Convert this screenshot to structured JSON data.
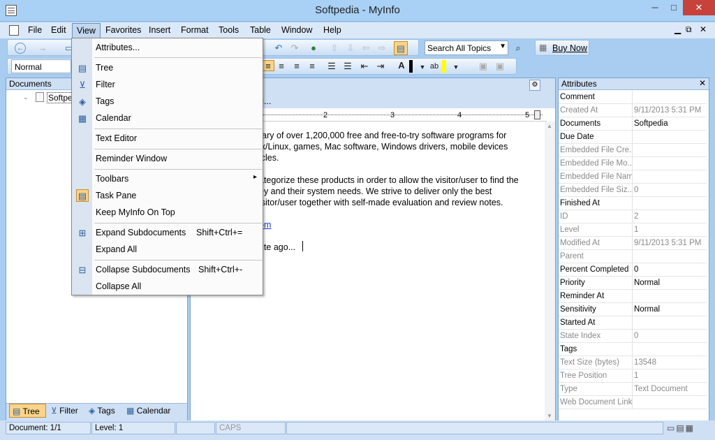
{
  "window": {
    "title": "Softpedia - MyInfo",
    "minimize": "─",
    "maximize": "□",
    "close": "✕"
  },
  "menubar": [
    "File",
    "Edit",
    "View",
    "Favorites",
    "Insert",
    "Format",
    "Tools",
    "Table",
    "Window",
    "Help"
  ],
  "toolbar": {
    "search_placeholder": "Search All Topics",
    "buy_now": "Buy Now",
    "style": "Normal"
  },
  "documents_pane": {
    "title": "Documents",
    "tree_item": "Softpe"
  },
  "bottom_tabs": [
    "Tree",
    "Filter",
    "Tags",
    "Calendar"
  ],
  "view_menu": {
    "items": [
      {
        "label": "Attributes...",
        "icon": ""
      },
      {
        "label": "Tree",
        "icon": "tree-icon"
      },
      {
        "label": "Filter",
        "icon": "filter-icon"
      },
      {
        "label": "Tags",
        "icon": "tag-icon"
      },
      {
        "label": "Calendar",
        "icon": "calendar-icon"
      },
      {
        "label": "Text Editor",
        "icon": ""
      },
      {
        "label": "Reminder Window",
        "icon": ""
      },
      {
        "label": "Toolbars",
        "icon": "",
        "submenu": "▸"
      },
      {
        "label": "Task Pane",
        "icon": "task-pane-icon"
      },
      {
        "label": "Keep MyInfo On Top",
        "icon": ""
      },
      {
        "label": "Expand Subdocuments",
        "shortcut": "Shift+Ctrl+=",
        "icon": "expand-icon"
      },
      {
        "label": "Expand All",
        "icon": ""
      },
      {
        "label": "Collapse Subdocuments",
        "shortcut": "Shift+Ctrl+-",
        "icon": "collapse-icon"
      },
      {
        "label": "Collapse All",
        "icon": ""
      }
    ]
  },
  "editor": {
    "heading": "g...",
    "lines": [
      "rary of over 1,200,000 free and free-to-try software programs for",
      "ix/Linux, games, Mac software, Windows drivers, mobile devices",
      "icles.",
      "ategorize these products in order to allow the visitor/user to find the",
      "ey and their system needs. We strive to deliver only the best",
      "isitor/user together with self-made evaluation and review notes.",
      "om",
      "ute ago..."
    ],
    "ruler": [
      "2",
      "3",
      "4",
      "5"
    ]
  },
  "attributes": {
    "title": "Attributes",
    "rows": [
      {
        "key": "Comment",
        "value": "",
        "dim": false
      },
      {
        "key": "Created At",
        "value": "9/11/2013 5:31 PM",
        "dim": true
      },
      {
        "key": "Documents",
        "value": "Softpedia",
        "dim": false
      },
      {
        "key": "Due Date",
        "value": "",
        "dim": false
      },
      {
        "key": "Embedded File Cre...",
        "value": "",
        "dim": true
      },
      {
        "key": "Embedded File Mo...",
        "value": "",
        "dim": true
      },
      {
        "key": "Embedded File Name",
        "value": "",
        "dim": true
      },
      {
        "key": "Embedded File Siz...",
        "value": "0",
        "dim": true
      },
      {
        "key": "Finished At",
        "value": "",
        "dim": false
      },
      {
        "key": "ID",
        "value": "2",
        "dim": true
      },
      {
        "key": "Level",
        "value": "1",
        "dim": true
      },
      {
        "key": "Modified At",
        "value": "9/11/2013 5:31 PM",
        "dim": true
      },
      {
        "key": "Parent",
        "value": "",
        "dim": true
      },
      {
        "key": "Percent Completed",
        "value": "0",
        "dim": false
      },
      {
        "key": "Priority",
        "value": "Normal",
        "dim": false
      },
      {
        "key": "Reminder At",
        "value": "",
        "dim": false
      },
      {
        "key": "Sensitivity",
        "value": "Normal",
        "dim": false
      },
      {
        "key": "Started At",
        "value": "",
        "dim": false
      },
      {
        "key": "State Index",
        "value": "0",
        "dim": true
      },
      {
        "key": "Tags",
        "value": "",
        "dim": false
      },
      {
        "key": "Text Size (bytes)",
        "value": "13548",
        "dim": true
      },
      {
        "key": "Tree Position",
        "value": "1",
        "dim": true
      },
      {
        "key": "Type",
        "value": "Text Document",
        "dim": true
      },
      {
        "key": "Web Document Link",
        "value": "",
        "dim": true
      }
    ]
  },
  "status": {
    "document": "Document: 1/1",
    "level": "Level: 1",
    "caps": "CAPS"
  }
}
